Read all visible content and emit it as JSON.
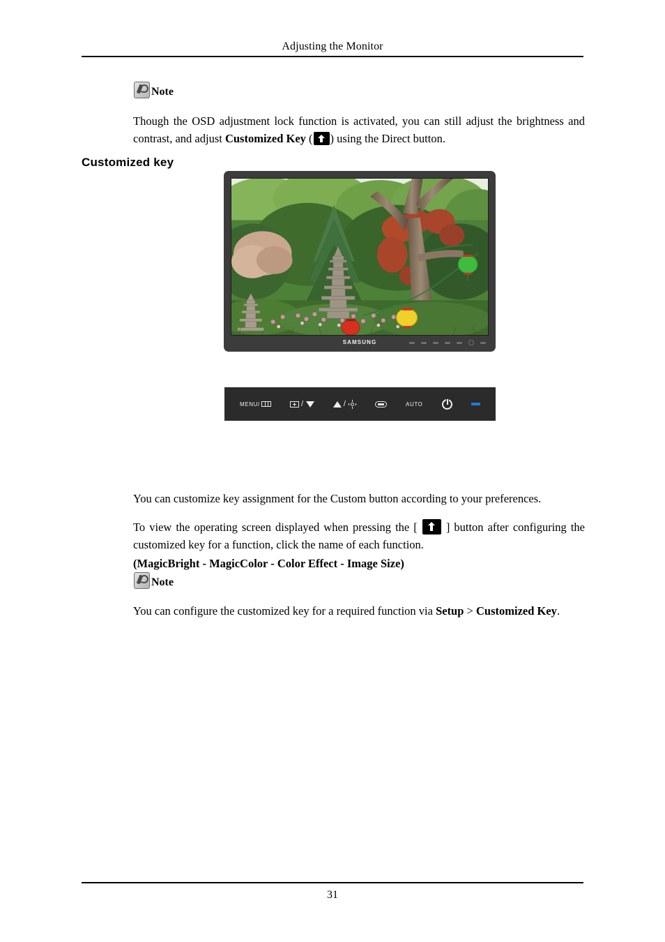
{
  "header": {
    "title": "Adjusting the Monitor"
  },
  "footer": {
    "page_number": "31"
  },
  "note_top": {
    "label": "Note",
    "icon": "note-pencil-icon",
    "paragraph_part1": "Though the OSD adjustment lock function is activated, you can still adjust the brightness and contrast, and adjust ",
    "paragraph_bold": "Customized Key",
    "paragraph_part2": " (",
    "paragraph_part3": ") using the Direct button."
  },
  "section": {
    "heading": "Customized key"
  },
  "monitor": {
    "brand_logo": "SAMSUNG",
    "screen_description": "Korean garden photo with stone pagoda, green trees, red and yellow lanterns"
  },
  "controls": {
    "menu_label": "MENU/",
    "menu_icon": "menu-bars-icon",
    "source_icon": "source-plus-box-icon",
    "down_icon": "triangle-down-icon",
    "up_icon": "triangle-up-icon",
    "brightness_icon": "brightness-sun-icon",
    "enter_icon": "enter-oval-icon",
    "auto_label": "AUTO",
    "power_icon": "power-icon",
    "led_icon": "power-led-indicator",
    "slash": "/"
  },
  "body": {
    "para1": "You can customize key assignment for the Custom button according to your preferences.",
    "para2_part1": "To view the operating screen displayed when pressing the [ ",
    "para2_part2": " ] button after configuring the customized key for a function, click the name of each function.",
    "functions_open": "(",
    "functions": [
      {
        "name": "MagicBright"
      },
      {
        "name": "MagicColor"
      },
      {
        "name": "Color Effect"
      },
      {
        "name": "Image Size"
      }
    ],
    "functions_separator": " - ",
    "functions_close": ")"
  },
  "note_bottom": {
    "label": "Note",
    "icon": "note-pencil-icon",
    "paragraph_part1": "You can configure the customized key for a required function via ",
    "paragraph_bold1": "Setup",
    "paragraph_mid": " > ",
    "paragraph_bold2": "Customized Key",
    "paragraph_end": "."
  }
}
